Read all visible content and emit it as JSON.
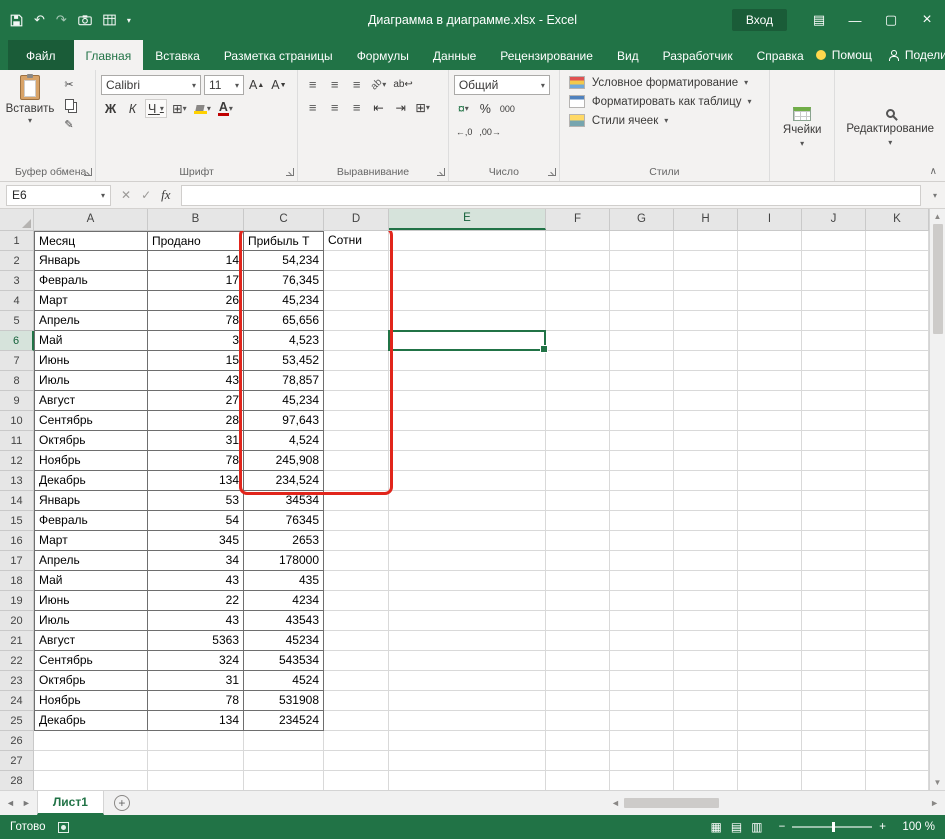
{
  "titlebar": {
    "title": "Диаграмма в диаграмме.xlsx - Excel",
    "signin_label": "Вход"
  },
  "tabs": {
    "file": "Файл",
    "items": [
      {
        "label": "Главная",
        "active": true
      },
      {
        "label": "Вставка",
        "active": false
      },
      {
        "label": "Разметка страницы",
        "active": false
      },
      {
        "label": "Формулы",
        "active": false
      },
      {
        "label": "Данные",
        "active": false
      },
      {
        "label": "Рецензирование",
        "active": false
      },
      {
        "label": "Вид",
        "active": false
      },
      {
        "label": "Разработчик",
        "active": false
      },
      {
        "label": "Справка",
        "active": false
      }
    ],
    "help": "Помощ",
    "share": "Поделиться"
  },
  "ribbon": {
    "paste_label": "Вставить",
    "font_name": "Calibri",
    "font_size": "11",
    "bold": "Ж",
    "italic": "К",
    "underline": "Ч",
    "font_color": "А",
    "grow_font": "А",
    "shrink_font": "А",
    "number_format": "Общий",
    "percent": "%",
    "thousands": "000",
    "style_buttons": [
      "Условное форматирование",
      "Форматировать как таблицу",
      "Стили ячеек"
    ],
    "cells_label": "Ячейки",
    "editing_label": "Редактирование",
    "groups": {
      "clipboard": "Буфер обмена",
      "font": "Шрифт",
      "alignment": "Выравнивание",
      "number": "Число",
      "styles": "Стили"
    }
  },
  "formula_bar": {
    "name_box": "E6",
    "fx_label": "fx"
  },
  "sheet": {
    "columns": [
      "A",
      "B",
      "C",
      "D",
      "E",
      "F",
      "G",
      "H",
      "I",
      "J",
      "K"
    ],
    "selected_cell": "E6",
    "rows": [
      [
        "Месяц",
        "Продано",
        "Прибыль Т",
        "Сотни"
      ],
      [
        "Январь",
        "14",
        "54,234"
      ],
      [
        "Февраль",
        "17",
        "76,345"
      ],
      [
        "Март",
        "26",
        "45,234"
      ],
      [
        "Апрель",
        "78",
        "65,656"
      ],
      [
        "Май",
        "3",
        "4,523"
      ],
      [
        "Июнь",
        "15",
        "53,452"
      ],
      [
        "Июль",
        "43",
        "78,857"
      ],
      [
        "Август",
        "27",
        "45,234"
      ],
      [
        "Сентябрь",
        "28",
        "97,643"
      ],
      [
        "Октябрь",
        "31",
        "4,524"
      ],
      [
        "Ноябрь",
        "78",
        "245,908"
      ],
      [
        "Декабрь",
        "134",
        "234,524"
      ],
      [
        "Январь",
        "53",
        "34534"
      ],
      [
        "Февраль",
        "54",
        "76345"
      ],
      [
        "Март",
        "345",
        "2653"
      ],
      [
        "Апрель",
        "34",
        "178000"
      ],
      [
        "Май",
        "43",
        "435"
      ],
      [
        "Июнь",
        "22",
        "4234"
      ],
      [
        "Июль",
        "43",
        "43543"
      ],
      [
        "Август",
        "5363",
        "45234"
      ],
      [
        "Сентябрь",
        "324",
        "543534"
      ],
      [
        "Октябрь",
        "31",
        "4524"
      ],
      [
        "Ноябрь",
        "78",
        "531908"
      ],
      [
        "Декабрь",
        "134",
        "234524"
      ]
    ]
  },
  "annotation": {
    "highlighted_range": "C1:D13",
    "color": "#e1251b"
  },
  "sheet_tabs": {
    "active": "Лист1"
  },
  "status_bar": {
    "ready": "Готово",
    "zoom": "100 %"
  }
}
